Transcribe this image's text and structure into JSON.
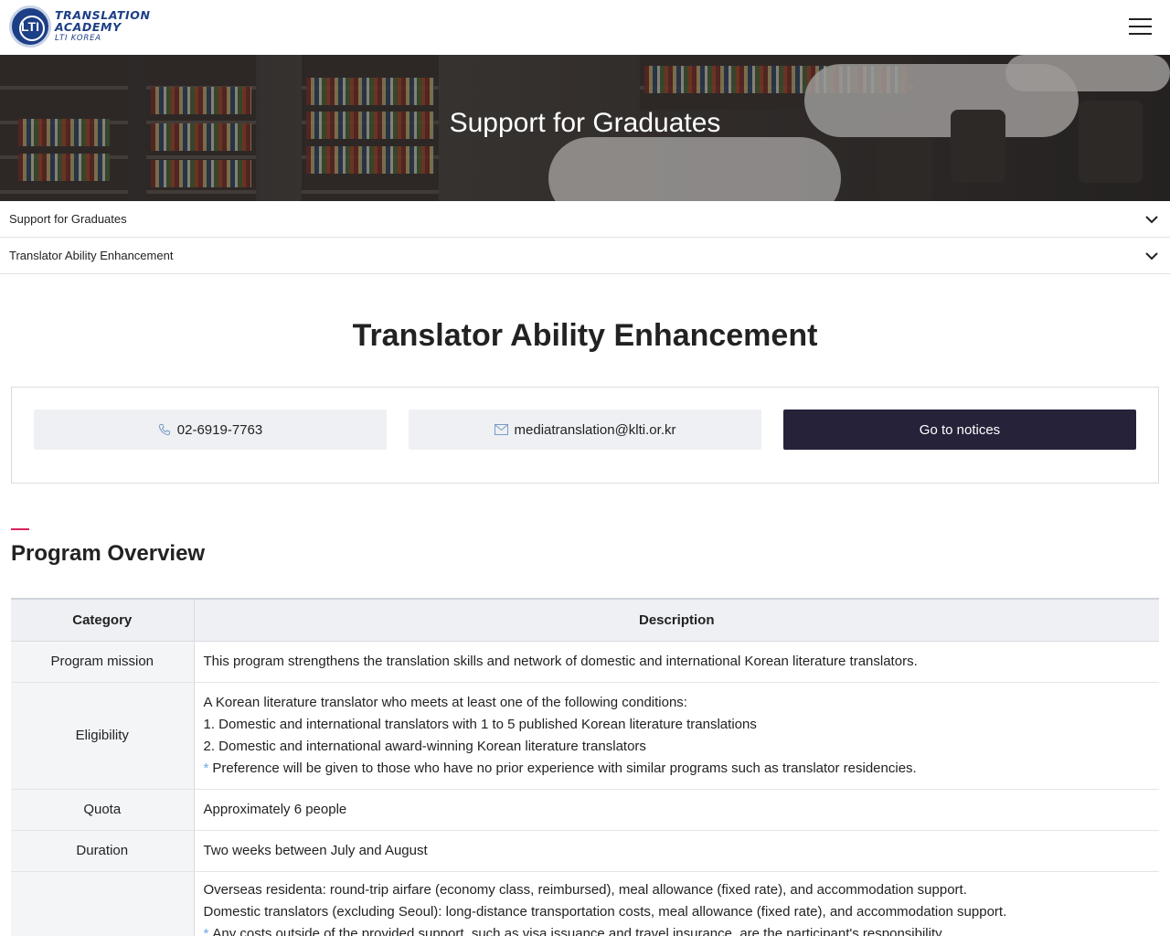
{
  "header": {
    "logo_emblem": "LTI",
    "logo_line1": "TRANSLATION",
    "logo_line2": "ACADEMY",
    "logo_line3": "LTI KOREA",
    "menu_icon": "hamburger-icon"
  },
  "hero": {
    "title": "Support for Graduates"
  },
  "dropdowns": [
    {
      "label": "Support for Graduates",
      "icon": "chevron-down-icon"
    },
    {
      "label": "Translator Ability Enhancement",
      "icon": "chevron-down-icon"
    }
  ],
  "main": {
    "title": "Translator Ability Enhancement"
  },
  "contact": {
    "phone": "02-6919-7763",
    "phone_icon": "phone-icon",
    "email": "mediatranslation@klti.or.kr",
    "email_icon": "envelope-icon",
    "notices_label": "Go to notices"
  },
  "overview": {
    "title": "Program Overview",
    "columns": [
      "Category",
      "Description"
    ],
    "rows": [
      {
        "category": "Program mission",
        "lines": [
          "This program strengthens the translation skills and network of domestic and international Korean literature translators."
        ]
      },
      {
        "category": "Eligibility",
        "lines": [
          "A Korean literature translator who meets at least one of the following conditions:",
          "1. Domestic and international translators with 1 to 5 published Korean literature translations",
          "2. Domestic and international award-winning Korean literature translators"
        ],
        "note": "Preference will be given to those who have no prior experience with similar programs such as translator residencies."
      },
      {
        "category": "Quota",
        "lines": [
          "Approximately 6 people"
        ]
      },
      {
        "category": "Duration",
        "lines": [
          "Two weeks between July and August"
        ]
      },
      {
        "category": "",
        "lines": [
          "Overseas residenta: round-trip airfare (economy class, reimbursed), meal allowance (fixed rate), and accommodation support.",
          "Domestic translators (excluding Seoul): long-distance transportation costs, meal allowance (fixed rate), and accommodation support."
        ],
        "note": "Any costs outside of the provided support, such as visa issuance and travel insurance, are the participant's responsibility."
      }
    ],
    "note_marker": "*"
  },
  "colors": {
    "brand_navy": "#1c3f86",
    "button_dark": "#25223a",
    "accent_pink": "#d8245b",
    "note_blue": "#6aa6e6"
  }
}
